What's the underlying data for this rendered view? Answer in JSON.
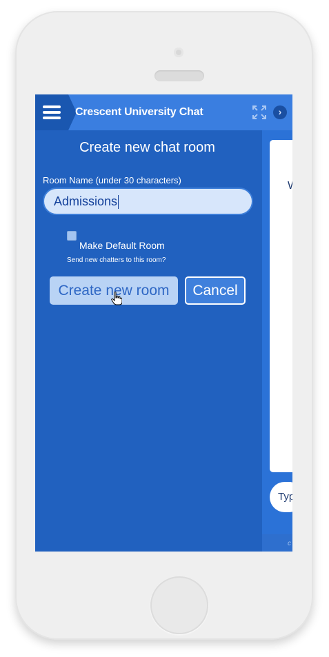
{
  "header": {
    "title": "Crescent University Chat",
    "icons": [
      "menu-icon",
      "expand-icon",
      "chevron-right-icon"
    ]
  },
  "form": {
    "title": "Create new chat room",
    "room_label": "Room Name (under 30 characters)",
    "room_value": "Admissions",
    "default_label": "Make Default Room",
    "default_help": "Send new chatters to this room?",
    "default_checked": false,
    "create_button": "Create new room",
    "cancel_button": "Cancel"
  },
  "right_panel": {
    "chat_fragment": "W",
    "input_fragment": "Typ",
    "footer_fragment": "c"
  },
  "colors": {
    "accent": "#3a7ee0",
    "panel": "#2161bf",
    "button_light": "#b9d3f5"
  }
}
